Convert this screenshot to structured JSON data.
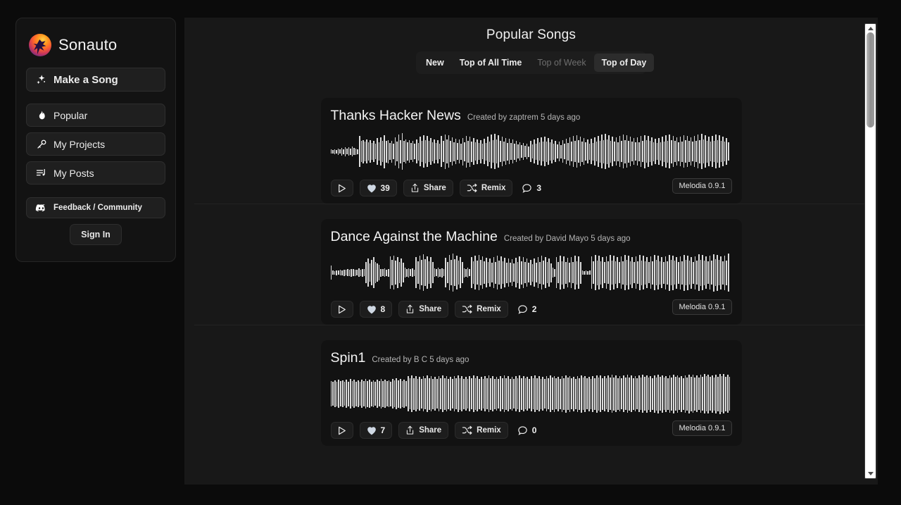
{
  "brand": {
    "name": "Sonauto",
    "logo_icon": "sonauto-bird-logo"
  },
  "sidebar": {
    "make_song": {
      "label": "Make a Song",
      "icon": "sparkles-icon"
    },
    "items": [
      {
        "label": "Popular",
        "icon": "flame-icon"
      },
      {
        "label": "My Projects",
        "icon": "microphone-icon"
      },
      {
        "label": "My Posts",
        "icon": "playlist-icon"
      }
    ],
    "feedback": {
      "label": "Feedback / Community",
      "icon": "discord-icon"
    },
    "sign_in": {
      "label": "Sign In"
    }
  },
  "main": {
    "title": "Popular Songs",
    "tabs": [
      {
        "label": "New",
        "state": "normal"
      },
      {
        "label": "Top of All Time",
        "state": "normal"
      },
      {
        "label": "Top of Week",
        "state": "dim"
      },
      {
        "label": "Top of Day",
        "state": "active"
      }
    ],
    "actions": {
      "play": "play-icon",
      "share_label": "Share",
      "remix_label": "Remix"
    },
    "songs": [
      {
        "title": "Thanks Hacker News",
        "meta": "Created by zaptrem 5 days ago",
        "likes": "39",
        "comments": "3",
        "model": "Melodia 0.9.1",
        "waveform": [
          6,
          5,
          7,
          5,
          9,
          6,
          11,
          7,
          13,
          8,
          12,
          9,
          14,
          10,
          9,
          7,
          44,
          30,
          33,
          28,
          34,
          26,
          32,
          24,
          30,
          22,
          38,
          26,
          40,
          30,
          47,
          31,
          33,
          24,
          31,
          22,
          40,
          28,
          48,
          33,
          52,
          30,
          34,
          26,
          32,
          24,
          30,
          22,
          34,
          25,
          42,
          30,
          46,
          33,
          44,
          30,
          38,
          27,
          34,
          24,
          33,
          22,
          44,
          30,
          49,
          34,
          46,
          30,
          40,
          27,
          36,
          24,
          34,
          23,
          39,
          27,
          45,
          31,
          43,
          29,
          38,
          26,
          35,
          24,
          33,
          22,
          36,
          25,
          42,
          29,
          48,
          32,
          50,
          34,
          46,
          30,
          42,
          28,
          38,
          25,
          36,
          24,
          34,
          23,
          30,
          20,
          26,
          18,
          24,
          16,
          22,
          15,
          30,
          20,
          34,
          23,
          38,
          26,
          40,
          28,
          42,
          29,
          38,
          26,
          34,
          23,
          30,
          20,
          28,
          19,
          32,
          22,
          36,
          25,
          40,
          28,
          44,
          30,
          46,
          32,
          42,
          29,
          38,
          26,
          34,
          23,
          36,
          25,
          40,
          28,
          44,
          31,
          48,
          33,
          50,
          35,
          46,
          31,
          42,
          28,
          40,
          27,
          44,
          30,
          48,
          33,
          46,
          31,
          42,
          28,
          38,
          26,
          40,
          27,
          44,
          30,
          47,
          32,
          44,
          30,
          40,
          27,
          36,
          24,
          38,
          26,
          42,
          29,
          46,
          31,
          48,
          33,
          44,
          30,
          40,
          27,
          42,
          29,
          46,
          32,
          44,
          30,
          40,
          28,
          44,
          30,
          48,
          33,
          50,
          34,
          46,
          31,
          42,
          28,
          44,
          30,
          48,
          32,
          46,
          30,
          42,
          28,
          38,
          26
        ]
      },
      {
        "title": "Dance Against the Machine",
        "meta": "Created by David Mayo 5 days ago",
        "likes": "8",
        "comments": "2",
        "model": "Melodia 0.9.1",
        "waveform": [
          20,
          6,
          5,
          7,
          6,
          8,
          7,
          9,
          8,
          10,
          9,
          11,
          10,
          9,
          8,
          12,
          9,
          11,
          10,
          30,
          40,
          26,
          36,
          44,
          30,
          26,
          22,
          11,
          10,
          12,
          9,
          11,
          46,
          36,
          48,
          34,
          44,
          30,
          40,
          28,
          14,
          11,
          13,
          10,
          12,
          9,
          44,
          32,
          48,
          36,
          52,
          38,
          46,
          32,
          44,
          30,
          12,
          10,
          14,
          11,
          13,
          10,
          42,
          30,
          50,
          36,
          54,
          38,
          48,
          34,
          44,
          30,
          13,
          11,
          14,
          10,
          44,
          32,
          48,
          34,
          50,
          36,
          46,
          32,
          42,
          30,
          40,
          28,
          44,
          31,
          48,
          34,
          46,
          32,
          42,
          29,
          40,
          28,
          38,
          26,
          42,
          30,
          46,
          33,
          44,
          30,
          40,
          28,
          36,
          25,
          40,
          28,
          44,
          31,
          48,
          34,
          44,
          30,
          40,
          27,
          14,
          11,
          44,
          30,
          48,
          33,
          46,
          31,
          42,
          28,
          44,
          30,
          48,
          33,
          46,
          31,
          6,
          5,
          6,
          5,
          6,
          46,
          32,
          50,
          35,
          48,
          33,
          44,
          30,
          46,
          32,
          50,
          34,
          48,
          32,
          44,
          30,
          46,
          33,
          50,
          36,
          48,
          33,
          44,
          30,
          46,
          32,
          50,
          35,
          48,
          33,
          44,
          30,
          46,
          33,
          50,
          36,
          48,
          33,
          44,
          31,
          47,
          33,
          51,
          36,
          49,
          34,
          45,
          31,
          47,
          33,
          51,
          36,
          49,
          34,
          45,
          31,
          47,
          34,
          52,
          37,
          50,
          35,
          46,
          32,
          48,
          34,
          53,
          38,
          51,
          36,
          47,
          33,
          49,
          35,
          54
        ]
      },
      {
        "title": "Spin1",
        "meta": "Created by B C 5 days ago",
        "likes": "7",
        "comments": "0",
        "model": "Melodia 0.9.1",
        "waveform": [
          36,
          34,
          38,
          35,
          40,
          36,
          38,
          34,
          40,
          35,
          42,
          36,
          40,
          35,
          38,
          34,
          40,
          36,
          42,
          37,
          40,
          35,
          38,
          34,
          40,
          36,
          42,
          37,
          40,
          36,
          38,
          35,
          42,
          38,
          44,
          39,
          42,
          37,
          40,
          36,
          50,
          44,
          52,
          45,
          50,
          43,
          48,
          42,
          50,
          44,
          52,
          45,
          50,
          43,
          48,
          42,
          50,
          44,
          52,
          45,
          50,
          43,
          48,
          42,
          50,
          44,
          52,
          45,
          50,
          43,
          48,
          42,
          50,
          44,
          52,
          45,
          50,
          43,
          48,
          42,
          50,
          44,
          52,
          45,
          50,
          43,
          48,
          42,
          50,
          44,
          52,
          45,
          50,
          43,
          48,
          42,
          50,
          44,
          52,
          45,
          50,
          44,
          48,
          42,
          50,
          44,
          52,
          45,
          50,
          43,
          48,
          42,
          50,
          44,
          52,
          46,
          51,
          44,
          49,
          43,
          51,
          45,
          53,
          46,
          51,
          44,
          49,
          43,
          51,
          45,
          53,
          46,
          51,
          44,
          49,
          43,
          51,
          45,
          53,
          47,
          52,
          45,
          50,
          44,
          52,
          46,
          54,
          47,
          52,
          45,
          50,
          44,
          52,
          46,
          54,
          47,
          52,
          45,
          50,
          44,
          52,
          46,
          54,
          48,
          53,
          46,
          51,
          45,
          53,
          47,
          55,
          48,
          53,
          46,
          51,
          45,
          53,
          47,
          55,
          48,
          53,
          46,
          51,
          45,
          53,
          47,
          55,
          49,
          54,
          47,
          52,
          46,
          54,
          48,
          56,
          50,
          55,
          48,
          53,
          47,
          55,
          49,
          57,
          51,
          56,
          49,
          54,
          48
        ]
      }
    ]
  },
  "scrollbar": {
    "name": "vertical-scrollbar"
  }
}
